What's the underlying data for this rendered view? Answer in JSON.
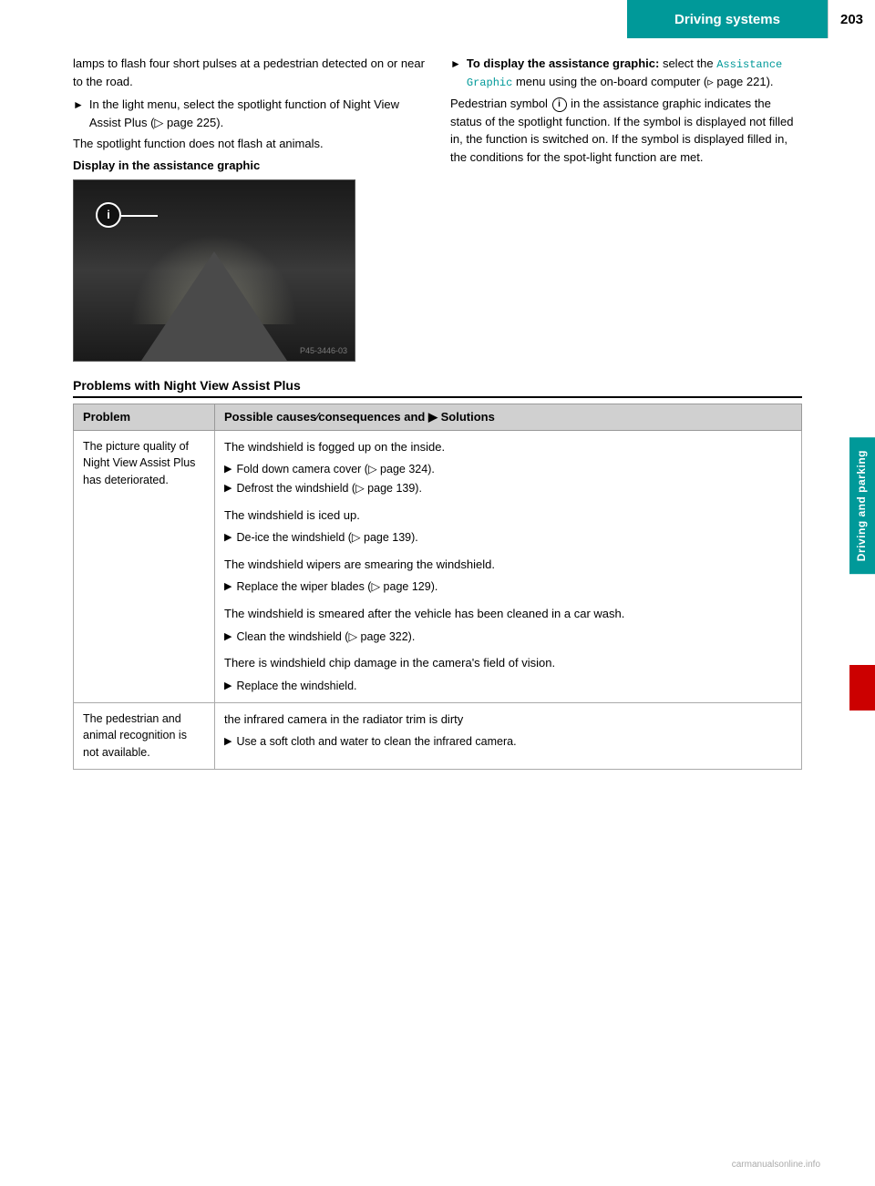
{
  "header": {
    "title": "Driving systems",
    "page_number": "203"
  },
  "side_tab": {
    "label": "Driving and parking"
  },
  "left_col": {
    "intro_text": "lamps to flash four short pulses at a pedestrian detected on or near to the road.",
    "bullet1": "In the light menu, select the spotlight function of Night View Assist Plus (▷ page 225).",
    "spotlight_text": "The spotlight function does not flash at animals.",
    "display_heading": "Display in the assistance graphic"
  },
  "right_col": {
    "to_display_prefix": "To display the assistance graphic:",
    "to_display_text": "select the",
    "menu_name": "Assistance Graphic",
    "to_display_text2": "menu using the on-board computer (▷ page 221).",
    "pedestrian_text": "Pedestrian symbol",
    "pedestrian_symbol": "i",
    "pedestrian_text2": "in the assistance graphic indicates the status of the spotlight function. If the symbol is displayed not filled in, the function is switched on. If the symbol is displayed filled in, the conditions for the spotlight function are met."
  },
  "problems_section": {
    "heading": "Problems with Night View Assist Plus",
    "table": {
      "col1_header": "Problem",
      "col2_header": "Possible causes∕consequences and ▶ Solutions",
      "rows": [
        {
          "problem": "The picture quality of Night View Assist Plus has deteriorated.",
          "solutions_groups": [
            {
              "text": "The windshield is fogged up on the inside.",
              "bullets": [
                "Fold down camera cover (▷ page 324).",
                "Defrost the windshield (▷ page 139)."
              ]
            },
            {
              "text": "The windshield is iced up.",
              "bullets": [
                "De-ice the windshield (▷ page 139)."
              ]
            },
            {
              "text": "The windshield wipers are smearing the windshield.",
              "bullets": [
                "Replace the wiper blades (▷ page 129)."
              ]
            },
            {
              "text": "The windshield is smeared after the vehicle has been cleaned in a car wash.",
              "bullets": [
                "Clean the windshield (▷ page 322)."
              ]
            },
            {
              "text": "There is windshield chip damage in the camera's field of vision.",
              "bullets": [
                "Replace the windshield."
              ]
            }
          ]
        },
        {
          "problem": "The pedestrian and animal recognition is not available.",
          "solutions_groups": [
            {
              "text": "the infrared camera in the radiator trim is dirty",
              "bullets": [
                "Use a soft cloth and water to clean the infrared camera."
              ]
            }
          ]
        }
      ]
    }
  },
  "watermark": "carmanualsonline.info"
}
